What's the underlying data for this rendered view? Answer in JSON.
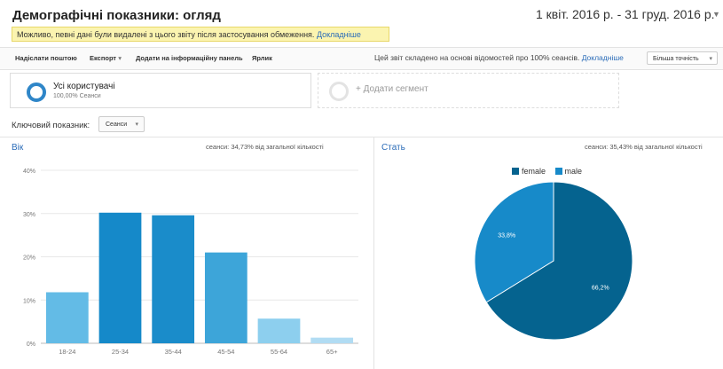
{
  "header": {
    "title": "Демографічні показники: огляд",
    "date_range": "1 квіт. 2016 р. - 31 груд. 2016 р."
  },
  "warning": {
    "text": "Можливо, певні дані були видалені з цього звіту після застосування обмеження. ",
    "link": "Докладніше"
  },
  "toolbar": {
    "email": "Надіслати поштою",
    "export": "Експорт",
    "dashboard": "Додати на інформаційну панель",
    "shortcut": "Ярлик",
    "sampling_text": "Цей звіт складено на основі відомостей про 100% сеансів. ",
    "sampling_link": "Докладніше",
    "precision": "Більша точність"
  },
  "segments": {
    "active_name": "Усі користувачі",
    "active_sub": "100,00% Сеанси",
    "add_label": "+ Додати сегмент"
  },
  "metric": {
    "label": "Ключовий показник:",
    "selected": "Сеанси"
  },
  "age_panel": {
    "title": "Вік",
    "note": "сеанси: 34,73% від загальної кількості"
  },
  "gender_panel": {
    "title": "Стать",
    "note": "сеанси: 35,43% від загальної кількості"
  },
  "colors": {
    "accent_blue": "#2f86c8",
    "link": "#2b6cb8",
    "female": "#05638f",
    "male": "#178ac9"
  },
  "chart_data": [
    {
      "type": "bar",
      "categories": [
        "18-24",
        "25-34",
        "35-44",
        "45-54",
        "55-64",
        "65+"
      ],
      "values": [
        11.8,
        30.2,
        29.6,
        21.0,
        5.7,
        1.3
      ],
      "ylabel": "",
      "yticks": [
        "0%",
        "10%",
        "20%",
        "30%",
        "40%"
      ],
      "ylim": [
        0,
        40
      ],
      "colors": [
        "#63bbe6",
        "#1589c9",
        "#1a8cca",
        "#3da5d9",
        "#8dcfee",
        "#b1dcf3"
      ]
    },
    {
      "type": "pie",
      "labels": [
        "female",
        "male"
      ],
      "values": [
        66.2,
        33.8
      ],
      "value_labels": [
        "66,2%",
        "33,8%"
      ],
      "colors": [
        "#05638f",
        "#178ac9"
      ],
      "legend": "top"
    }
  ]
}
